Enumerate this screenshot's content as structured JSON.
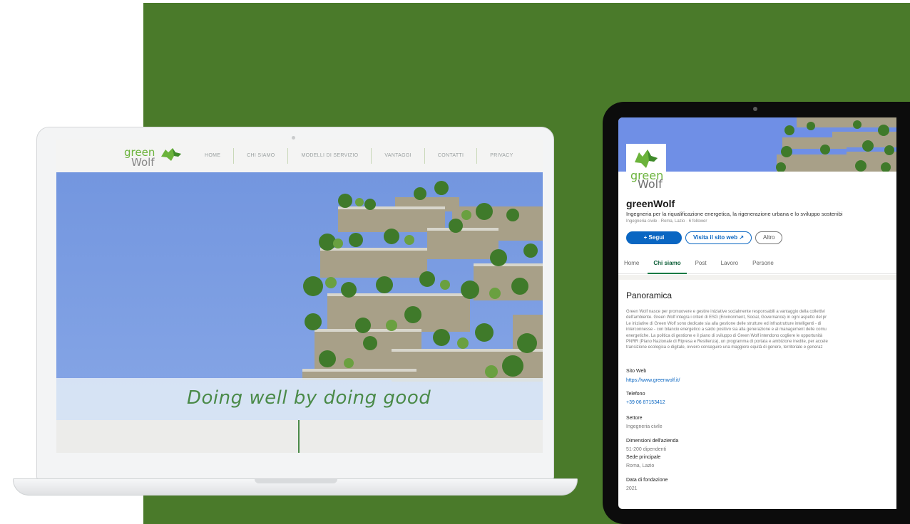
{
  "website": {
    "logo": {
      "line1": "green",
      "line2": "Wolf"
    },
    "nav": [
      "HOME",
      "CHI SIAMO",
      "MODELLI DI SERVIZIO",
      "VANTAGGI",
      "CONTATTI",
      "PRIVACY"
    ],
    "tagline": "Doing well by doing good",
    "colors": {
      "brand_green": "#4a8a48",
      "sky": "#7396df"
    }
  },
  "linkedin": {
    "logo": {
      "line1": "green",
      "line2": "Wolf"
    },
    "company_name": "greenWolf",
    "tagline": "Ingegneria per la riqualificazione energetica, la rigenerazione urbana e lo sviluppo sostenibi",
    "meta": "Ingegneria civile · Roma, Lazio · 6 follower",
    "buttons": {
      "follow": "+ Segui",
      "website": "Visita il sito web ↗",
      "more": "Altro"
    },
    "tabs": [
      "Home",
      "Chi siamo",
      "Post",
      "Lavoro",
      "Persone"
    ],
    "active_tab": "Chi siamo",
    "overview_title": "Panoramica",
    "overview_lines": [
      "Green Wolf nasce per promuovere e gestire iniziative socialmente responsabili a vantaggio della collettivi",
      "dell'ambiente. Green Wolf integra i criteri di ESG (Environment, Social, Governance) in ogni aspetto del pr",
      "Le iniziative di Green Wolf sono dedicate sia alla gestione delle strutture ed infrastrutture intelligenti - di",
      "interconnesse - con bilancio energetico a saldo positivo sia alla generazione e al management delle comu",
      "energetiche. La politica di gestione e il piano di sviluppo di Green Wolf intendono cogliere le opportunità",
      "PNRR (Piano Nazionale di Ripresa e Resilienza), un programma di portata e ambizione inedite, per accele",
      "transizione ecologica e digitale, ovvero conseguire una maggiore equità di genere, territoriale e generaz"
    ],
    "fields": [
      {
        "label": "Sito Web",
        "value": "https://www.greenwolf.it/",
        "link": true
      },
      {
        "label": "Telefono",
        "value": "+39 06 87153412",
        "link": true
      },
      {
        "label": "Settore",
        "value": "Ingegneria civile",
        "link": false
      },
      {
        "label": "Dimensioni dell'azienda",
        "value": "51-200 dipendenti",
        "link": false
      },
      {
        "label": "Sede principale",
        "value": "Roma, Lazio",
        "link": false
      },
      {
        "label": "Data di fondazione",
        "value": "2021",
        "link": false
      }
    ],
    "colors": {
      "primary_blue": "#0a66c2",
      "active_tab_green": "#0b7a43"
    }
  },
  "background_color": "#4a7a2a"
}
